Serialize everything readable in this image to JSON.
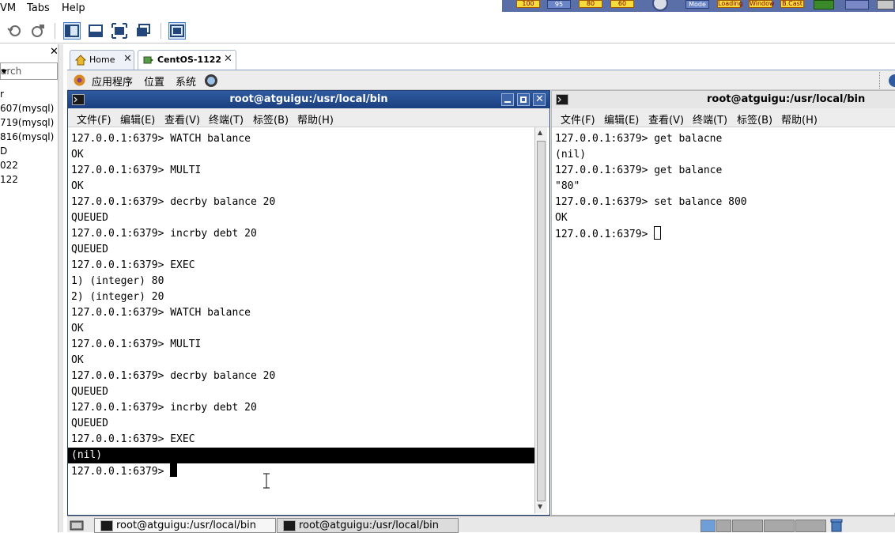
{
  "menubar": {
    "items": [
      "VM",
      "Tabs",
      "Help"
    ]
  },
  "indicators": [
    "100",
    "95",
    "80",
    "60",
    "Mode",
    "Loading",
    "Window",
    "B.Cast"
  ],
  "library": {
    "search_placeholder": "arch",
    "items": [
      "r",
      "607(mysql)",
      "719(mysql)",
      "816(mysql)",
      "D",
      "022",
      "122"
    ]
  },
  "tabs": [
    {
      "label": "Home"
    },
    {
      "label": "CentOS-1122"
    }
  ],
  "gnome_panel": {
    "items": [
      "应用程序",
      "位置",
      "系统"
    ]
  },
  "term_left": {
    "title": "root@atguigu:/usr/local/bin",
    "menu": [
      "文件(F)",
      "编辑(E)",
      "查看(V)",
      "终端(T)",
      "标签(B)",
      "帮助(H)"
    ],
    "lines": [
      "127.0.0.1:6379> WATCH balance",
      "OK",
      "127.0.0.1:6379> MULTI",
      "OK",
      "127.0.0.1:6379> decrby balance 20",
      "QUEUED",
      "127.0.0.1:6379> incrby debt 20",
      "QUEUED",
      "127.0.0.1:6379> EXEC",
      "1) (integer) 80",
      "2) (integer) 20",
      "127.0.0.1:6379> WATCH balance",
      "OK",
      "127.0.0.1:6379> MULTI",
      "OK",
      "127.0.0.1:6379> decrby balance 20",
      "QUEUED",
      "127.0.0.1:6379> incrby debt 20",
      "QUEUED",
      "127.0.0.1:6379> EXEC",
      "(nil)",
      "127.0.0.1:6379> "
    ]
  },
  "term_right": {
    "title": "root@atguigu:/usr/local/bin",
    "menu": [
      "文件(F)",
      "编辑(E)",
      "查看(V)",
      "终端(T)",
      "标签(B)",
      "帮助(H)"
    ],
    "lines": [
      "127.0.0.1:6379> get balacne",
      "(nil)",
      "127.0.0.1:6379> get balance",
      "\"80\"",
      "127.0.0.1:6379> set balance 800",
      "OK",
      "127.0.0.1:6379> "
    ]
  },
  "taskbar": {
    "tasks": [
      "root@atguigu:/usr/local/bin",
      "root@atguigu:/usr/local/bin"
    ]
  },
  "colors": {
    "title_active": "#1b3f80",
    "highlight_line": "#000000"
  }
}
